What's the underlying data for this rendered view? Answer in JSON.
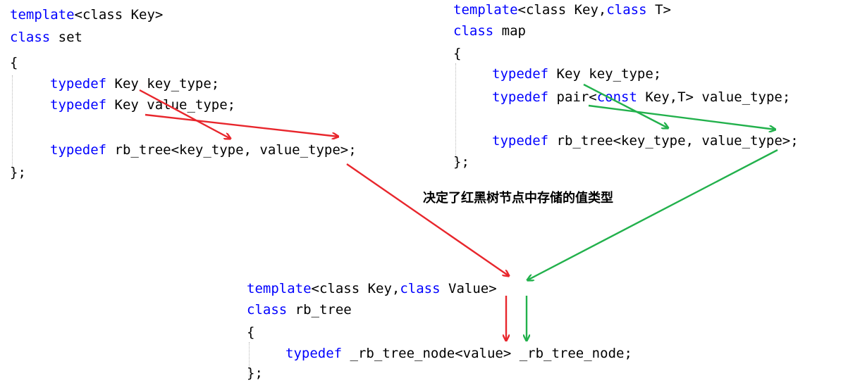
{
  "set_code": {
    "template_kw": "template",
    "template_rest": "<class Key>",
    "class_kw": "class",
    "class_name": " set",
    "open_brace": "{",
    "l1_kw": "typedef",
    "l1_rest": " Key key_type;",
    "l2_kw": "typedef",
    "l2_rest": " Key value_type;",
    "l3_kw": "typedef",
    "l3_rest": " rb_tree<key_type, value_type>;",
    "close_brace": "};"
  },
  "map_code": {
    "template_kw": "template",
    "template_mid": "<class Key,",
    "template_kw2": "class",
    "template_rest": " T>",
    "class_kw": "class",
    "class_name": " map",
    "open_brace": "{",
    "l1_kw": "typedef",
    "l1_rest": " Key key_type;",
    "l2_kw": "typedef",
    "l2_mid": " pair<",
    "l2_kw2": "const",
    "l2_rest": " Key,T> value_type;",
    "l3_kw": "typedef",
    "l3_rest": " rb_tree<key_type, value_type>;",
    "close_brace": "};"
  },
  "rb_code": {
    "template_kw": "template",
    "template_mid": "<class Key,",
    "template_kw2": "class",
    "template_rest": " Value>",
    "class_kw": "class",
    "class_name": " rb_tree",
    "open_brace": "{",
    "l1_kw": "typedef",
    "l1_rest": " _rb_tree_node<value> _rb_tree_node;",
    "close_brace": "};"
  },
  "caption": "决定了红黑树节点中存储的值类型",
  "colors": {
    "keyword": "#0000ff",
    "text": "#000000",
    "set_arrow": "#e8262c",
    "map_arrow": "#22b14c"
  }
}
